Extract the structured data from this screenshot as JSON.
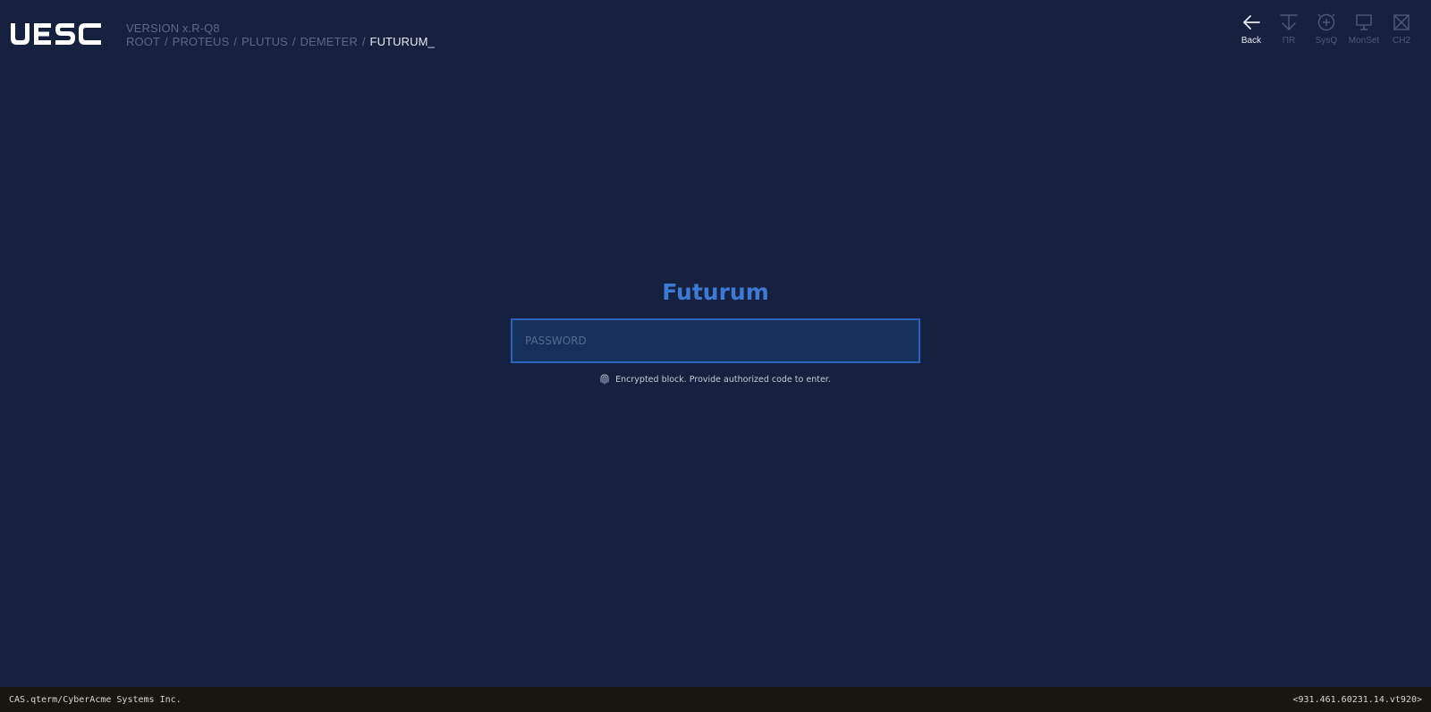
{
  "header": {
    "logo_text": "UESC",
    "version": "VERSION x.R-Q8",
    "breadcrumb": [
      "ROOT",
      "PROTEUS",
      "PLUTUS",
      "DEMETER",
      "FUTURUM_"
    ],
    "separator": "/"
  },
  "toolbar": {
    "items": [
      {
        "label": "Back",
        "icon": "arrow-left-icon",
        "active": true
      },
      {
        "label": "ΠR",
        "icon": "download-arrow-icon",
        "active": false
      },
      {
        "label": "SysQ",
        "icon": "crosshair-plus-icon",
        "active": false
      },
      {
        "label": "MonSet",
        "icon": "monitor-icon",
        "active": false
      },
      {
        "label": "CH2",
        "icon": "close-box-icon",
        "active": false
      }
    ]
  },
  "login": {
    "title": "Futurum",
    "password_placeholder": "PASSWORD",
    "password_value": "",
    "hint": "Encrypted block. Provide authorized code to enter.",
    "hint_icon": "fingerprint-icon"
  },
  "footer": {
    "left": "CAS.qterm/CyberAcme Systems Inc.",
    "right": "<931.461.60231.14.vt920>"
  },
  "colors": {
    "background": "#15213f",
    "accent": "#3d7ad6",
    "input_border": "#2a63c2",
    "input_bg": "#16305c",
    "footer_bg": "#191612"
  }
}
